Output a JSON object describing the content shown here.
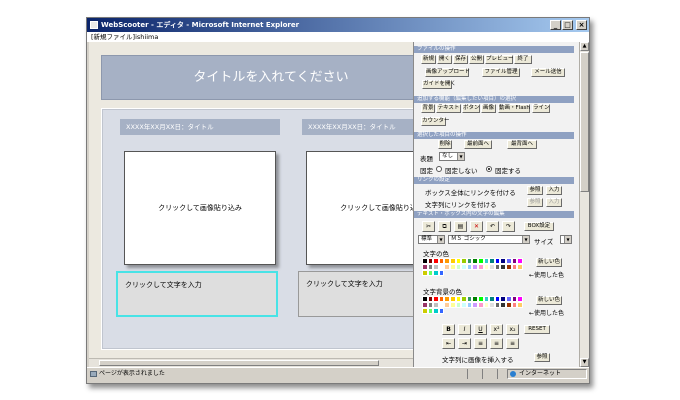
{
  "window": {
    "title": "WebScooter - エディタ - Microsoft Internet Explorer",
    "controls": [
      "_",
      "□",
      "×"
    ]
  },
  "menubar": {
    "text": "[新規ファイル]ishiima"
  },
  "editor": {
    "page_title": "タイトルを入れてください",
    "columns": [
      {
        "heading": "XXXX年XX月XX日：タイトル",
        "image_placeholder": "クリックして画像貼り込み",
        "text_placeholder": "クリックして文字を入力"
      },
      {
        "heading": "XXXX年XX月XX日：タイトル",
        "image_placeholder": "クリックして画像貼り込み",
        "text_placeholder": "クリックして文字を入力"
      }
    ]
  },
  "panel": {
    "file_section": "ファイルの操作",
    "file_buttons": [
      "新規",
      "開く",
      "保存",
      "公開",
      "プレビュー",
      "終了"
    ],
    "file_buttons2": [
      "画像アップロード",
      "ファイル管理",
      "メール送信"
    ],
    "guide_button": "ガイドを開く",
    "add_section": "追加する機能（編集したい項目）の選択",
    "add_buttons": [
      "背景",
      "テキスト",
      "ボタン",
      "画像",
      "動画・Flash",
      "ライン"
    ],
    "counter_button": "カウンター",
    "selected_section": "選択した項目の操作",
    "order_buttons": [
      "削除",
      "最前面へ",
      "最背面へ"
    ],
    "align_label": "表題",
    "align_value": "なし",
    "fix_label": "固定",
    "fix_options": [
      "固定しない",
      "固定する"
    ],
    "fix_selected": 1,
    "link_section": "リンクの設定",
    "link_box_label": "ボックス全体にリンクを付ける",
    "link_text_label": "文字列にリンクを付ける",
    "browse": "参照",
    "input": "入力",
    "text_section": "テキスト・ボックス内の文字の編集",
    "box_setting": "BOX設定",
    "style_value": "標準",
    "font_value": "ＭＳ ゴシック",
    "size_label": "サイズ",
    "text_color_label": "文字の色",
    "bg_color_label": "文字背景の色",
    "new_color": "新しい色",
    "used_color": "←使用した色",
    "format_buttons": [
      "B",
      "I",
      "U",
      "x²",
      "x₂",
      "RESET"
    ],
    "indent_buttons": [
      "⇤",
      "⇥",
      "≡",
      "≡",
      "≡"
    ],
    "insert_image_label": "文字列に画像を挿入する",
    "icons": [
      "cut-icon",
      "copy-icon",
      "paste-icon",
      "delete-icon",
      "undo-icon",
      "redo-icon"
    ],
    "palette_colors": [
      "#000000",
      "#800000",
      "#ff0000",
      "#ff6600",
      "#ff9900",
      "#ffcc00",
      "#ffff00",
      "#99cc00",
      "#339966",
      "#008000",
      "#00ff00",
      "#33cccc",
      "#008080",
      "#0000ff",
      "#000080",
      "#6666ff",
      "#800080",
      "#ff00ff",
      "#993366",
      "#808080",
      "#c0c0c0",
      "#ffffff",
      "#ffcc99",
      "#ffff99",
      "#ccffcc",
      "#ccffff",
      "#99ccff",
      "#cc99ff",
      "#ff99cc",
      "#ffffcc",
      "#e0e0e0",
      "#666666",
      "#333333",
      "#993300",
      "#ff8080",
      "#ffcc66",
      "#cccc00",
      "#66ff66",
      "#00cccc",
      "#3366ff"
    ]
  },
  "statusbar": {
    "text": "ページが表示されました",
    "zone": "インターネット"
  }
}
